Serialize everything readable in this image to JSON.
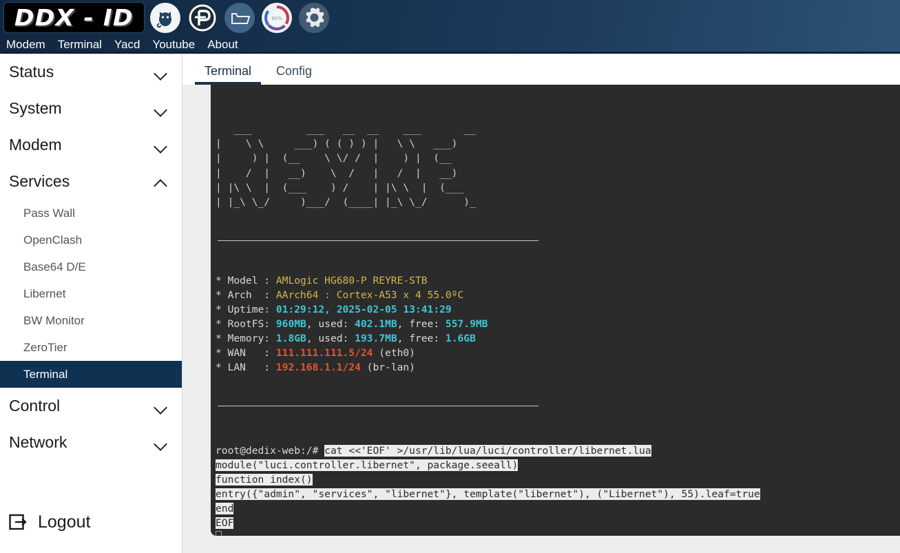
{
  "header": {
    "logo_text": "DDX - ID",
    "icons": [
      {
        "name": "yacd-cat-icon",
        "label": "Yacd"
      },
      {
        "name": "passwall-p-icon",
        "label": "PassWall"
      },
      {
        "name": "file-folder-icon",
        "label": "Files"
      },
      {
        "name": "bandwidth-gauge-icon",
        "label": "BW Monitor"
      },
      {
        "name": "gear-settings-icon",
        "label": "Settings"
      }
    ],
    "nav": [
      {
        "label": "Modem"
      },
      {
        "label": "Terminal"
      },
      {
        "label": "Yacd"
      },
      {
        "label": "Youtube"
      },
      {
        "label": "About"
      }
    ]
  },
  "sidebar": {
    "groups": [
      {
        "label": "Status",
        "expanded": false
      },
      {
        "label": "System",
        "expanded": false
      },
      {
        "label": "Modem",
        "expanded": false
      },
      {
        "label": "Services",
        "expanded": true
      }
    ],
    "services_items": [
      {
        "label": "Pass Wall",
        "active": false
      },
      {
        "label": "OpenClash",
        "active": false
      },
      {
        "label": "Base64 D/E",
        "active": false
      },
      {
        "label": "Libernet",
        "active": false
      },
      {
        "label": "BW Monitor",
        "active": false
      },
      {
        "label": "ZeroTier",
        "active": false
      },
      {
        "label": "Terminal",
        "active": true
      }
    ],
    "groups_after": [
      {
        "label": "Control",
        "expanded": false
      },
      {
        "label": "Network",
        "expanded": false
      }
    ],
    "logout_label": "Logout"
  },
  "tabs": [
    {
      "label": "Terminal",
      "active": true
    },
    {
      "label": "Config",
      "active": false
    }
  ],
  "terminal": {
    "ascii_art": "   ___         ___   __  __    ___       __\n|    \\ \\     ___) ( ( ) ) |   \\ \\   ___)\n|     ) |  (__    \\ \\/ /  |    ) |  (__\n|    /  |   __)    \\  /   |   /  |   __)\n| |\\ \\  |  (___    ) /    | |\\ \\  |  (___\n| |_\\ \\_/     )___/  (____| |_\\ \\_/      )_",
    "sysinfo": [
      {
        "star": "*",
        "key": "Model ",
        "sep": ": ",
        "segments": [
          {
            "text": "AMLogic HG680-P REYRE-STB",
            "color": "yellow"
          }
        ]
      },
      {
        "star": "*",
        "key": "Arch  ",
        "sep": ": ",
        "segments": [
          {
            "text": "AArch64 : Cortex-A53 x 4 55.0ºC",
            "color": "yellow"
          }
        ]
      },
      {
        "star": "*",
        "key": "Uptime",
        "sep": ": ",
        "segments": [
          {
            "text": "01:29:12, 2025-02-05 13:41:29",
            "color": "cyan"
          }
        ]
      },
      {
        "star": "*",
        "key": "RootFS",
        "sep": ": ",
        "segments": [
          {
            "text": "960MB",
            "color": "cyan"
          },
          {
            "text": ", used: ",
            "color": "plain"
          },
          {
            "text": "402.1MB",
            "color": "cyan"
          },
          {
            "text": ", free: ",
            "color": "plain"
          },
          {
            "text": "557.9MB",
            "color": "cyan"
          }
        ]
      },
      {
        "star": "*",
        "key": "Memory",
        "sep": ": ",
        "segments": [
          {
            "text": "1.8GB",
            "color": "cyan"
          },
          {
            "text": ", used: ",
            "color": "plain"
          },
          {
            "text": "193.7MB",
            "color": "cyan"
          },
          {
            "text": ", free: ",
            "color": "plain"
          },
          {
            "text": "1.6GB",
            "color": "cyan"
          }
        ]
      },
      {
        "star": "*",
        "key": "WAN   ",
        "sep": ": ",
        "segments": [
          {
            "text": "111.111.111.5/24",
            "color": "red"
          },
          {
            "text": " (eth0)",
            "color": "plain"
          }
        ]
      },
      {
        "star": "*",
        "key": "LAN   ",
        "sep": ": ",
        "segments": [
          {
            "text": "192.168.1.1/24",
            "color": "red"
          },
          {
            "text": " (br-lan)",
            "color": "plain"
          }
        ]
      }
    ],
    "prompt": "root@dedix-web:/# ",
    "command_lines": [
      {
        "prompt": true,
        "text": "cat <<'EOF' >/usr/lib/lua/luci/controller/libernet.lua",
        "selected": true
      },
      {
        "prompt": false,
        "text": "module(\"luci.controller.libernet\", package.seeall)",
        "selected": true
      },
      {
        "prompt": false,
        "text": "function index()",
        "selected": true
      },
      {
        "prompt": false,
        "text": "entry({\"admin\", \"services\", \"libernet\"}, template(\"libernet\"), (\"Libernet\"), 55).leaf=true",
        "selected": true
      },
      {
        "prompt": false,
        "text": "end",
        "selected": true
      },
      {
        "prompt": false,
        "text": "EOF",
        "selected": true
      }
    ],
    "cursor_visible": true
  },
  "colors": {
    "header_bg": "#16314f",
    "sidebar_active": "#0f3152",
    "terminal_bg": "#2b2b2b",
    "accent_yellow": "#d3b84c",
    "accent_cyan": "#3fc6d6",
    "accent_red": "#e2562f",
    "selection_bg": "#ececec"
  }
}
